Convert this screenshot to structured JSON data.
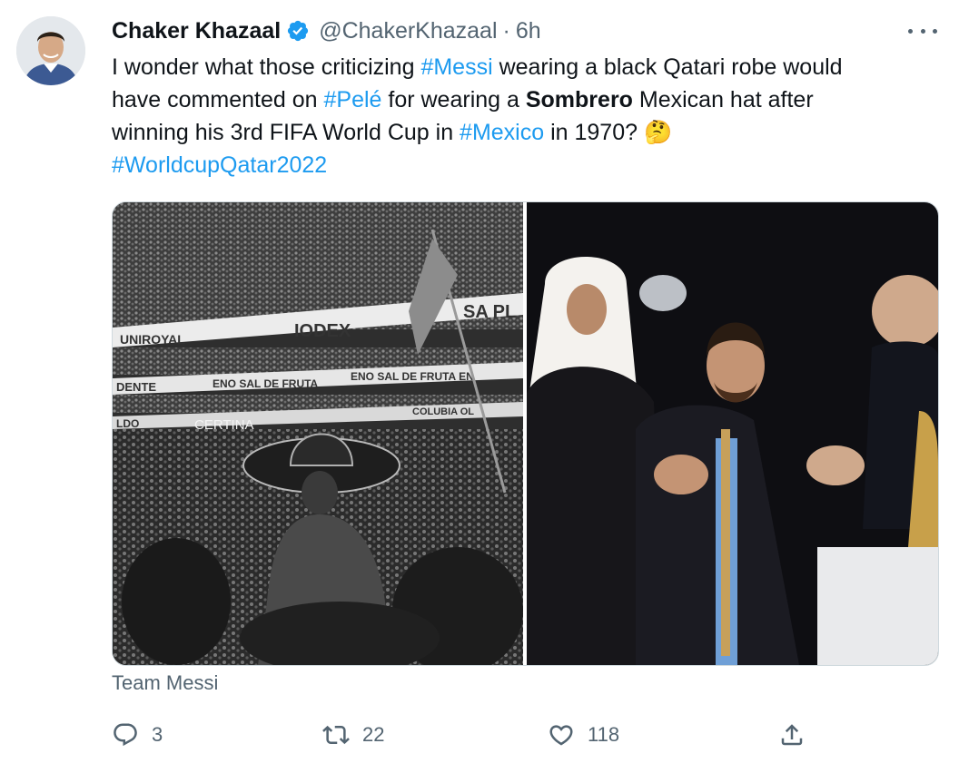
{
  "tweet": {
    "author": {
      "name": "Chaker Khazaal",
      "handle": "@ChakerKhazaal",
      "time": "6h",
      "separator": "·"
    },
    "text": {
      "l1_a": "I wonder what those criticizing ",
      "l1_tag": "#Messi",
      "l1_b": " wearing a black Qatari robe would",
      "l2_a": "have commented on ",
      "l2_tag": "#Pelé",
      "l2_b": " for wearing a ",
      "l2_bold": "Sombrero",
      "l2_c": " Mexican hat after",
      "l3_a": "winning his 3rd FIFA World Cup in ",
      "l3_tag": "#Mexico",
      "l3_b": " in 1970? 🤔",
      "l4_tag": "#WorldcupQatar2022"
    },
    "media_caption": "Team Messi",
    "media_left_banners": {
      "b1": "UNIROYAL",
      "b2": "IODEX",
      "b3": "SA PL",
      "b4": "DENTE",
      "b5": "ENO SAL DE FRUTA",
      "b6": "ENO SAL DE FRUTA EN",
      "b7": "LDO",
      "b8": "CERTINA",
      "b9": "COLUBIA OL"
    },
    "actions": {
      "replies": "3",
      "retweets": "22",
      "likes": "118"
    },
    "colors": {
      "accent": "#1d9bf0",
      "muted": "#536471",
      "text": "#0f1419",
      "border": "#cfd9de"
    },
    "icons": [
      "verified-badge-icon",
      "more-icon",
      "reply-icon",
      "retweet-icon",
      "like-icon",
      "share-icon"
    ]
  }
}
